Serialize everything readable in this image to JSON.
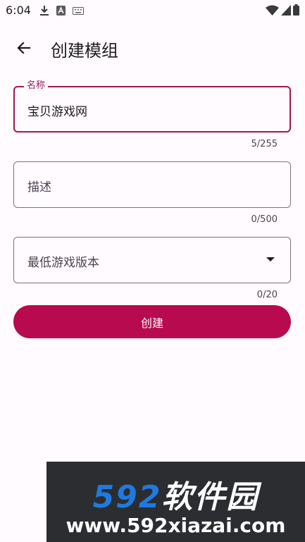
{
  "status_bar": {
    "time": "6:04",
    "left_icons": [
      "download-icon",
      "keyboard-a-icon",
      "keyboard-icon"
    ],
    "right_icons": [
      "wifi-icon",
      "signal-icon",
      "battery-icon"
    ]
  },
  "app_bar": {
    "title": "创建模组"
  },
  "form": {
    "name": {
      "label": "名称",
      "value": "宝贝游戏网",
      "counter": "5/255"
    },
    "description": {
      "placeholder": "描述",
      "counter": "0/500"
    },
    "min_version": {
      "placeholder": "最低游戏版本",
      "counter": "0/20"
    },
    "submit_label": "创建"
  },
  "watermark": {
    "brand_num": "592",
    "brand_text": "软件园",
    "url": "www.592xiazai.com"
  },
  "colors": {
    "accent": "#b80a4f",
    "focus": "#a0155a",
    "background": "#fffbfe"
  }
}
